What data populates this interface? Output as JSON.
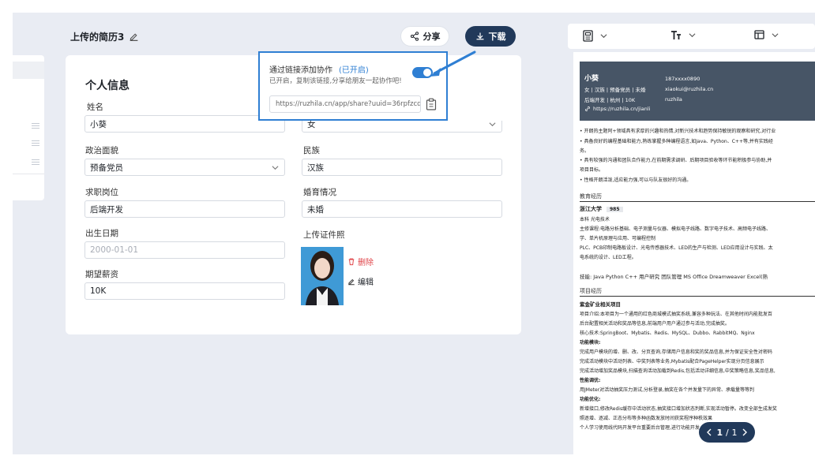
{
  "header": {
    "doc_title": "上传的简历3",
    "share_label": "分享",
    "download_label": "下载"
  },
  "form": {
    "section_title": "个人信息",
    "fields": {
      "name": {
        "label": "姓名",
        "value": "小葵"
      },
      "gender": {
        "label": "",
        "value": "女"
      },
      "political": {
        "label": "政治面貌",
        "value": "预备党员"
      },
      "ethnicity": {
        "label": "民族",
        "value": "汉族"
      },
      "job": {
        "label": "求职岗位",
        "value": "后端开发"
      },
      "marital": {
        "label": "婚育情况",
        "value": "未婚"
      },
      "birth": {
        "label": "出生日期",
        "placeholder": "2000-01-01"
      },
      "salary": {
        "label": "期望薪资",
        "value": "10K"
      },
      "photo": {
        "label": "上传证件照"
      }
    },
    "photo_actions": {
      "delete": "删除",
      "edit": "编辑"
    }
  },
  "share_popover": {
    "title": "通过链接添加协作",
    "status": "(已开启)",
    "description": "已开启，复制该链接,分享给朋友一起协作吧!",
    "link": "https://ruzhila.cn/app/share?uuid=36rpfzcd...",
    "toggle_on": true
  },
  "resume_preview": {
    "name": "小葵",
    "meta_line1": "女 | 汉族 | 预备党员 | 未婚",
    "meta_line2": "后端开发 | 杭州 | 10K",
    "phone": "187xxxx0890",
    "email": "xiaokui@ruzhila.cn",
    "wechat": "ruzhila",
    "website": "https://ruzhila.cn/jianli",
    "summary": [
      "• 开朗热主题阿+领域具有求厚的兴趣和热情,对新兴技术和趋势保持敏锐的观察和研究,对行业",
      "• 具备良好的编程基础和能力,熟练掌握多种编程语言,如Java、Python、C++等,并有实践经",
      "  务。",
      "• 具有较强的沟通和团队合作能力,在前期需求调研、后期项目验收等环节能积极参与协助,并",
      "  项目目标。",
      "• 性格开朗活泼,适应能力强,可以与队友很好的沟通。"
    ],
    "edu_title": "教育经历",
    "school": "浙江大学",
    "school_badge": "985",
    "edu_lines": [
      "本科   光电技术",
      "主修课程:电路分析基础、电子测量与仪器、模拟电子线路、数字电子技术、高频电子线路、",
      "学、单片机原理与应用、可编程控制",
      "PLC、PCB印制电路板设计、光电传感器技术、LED的生产与检测、LED应用设计与实践、太",
      "电系统的设计、LED工程。"
    ],
    "skills": "技能:  Java   Python   C++   用户研究   团队管理   MS Office   Dreamweaver   Excel(熟",
    "proj_title": "项目经历",
    "proj_name": "紫金矿业相关项目",
    "proj_lines": [
      "项目介绍:本项目为一个通用的红色商城模式抽奖系统,兼容多种玩法、在其他时间内能批发百",
      "后台配置相关活动和奖品等信息,前端用户用户通过参与活动,完成抽奖。",
      "核心技术:SpringBoot、Mybatis、Redis、MySQL、Dubbo、RabbitMQ、Nginx",
      "功能模块:",
      "完成用户模块的增、删、改、分页查询,存储用户信息和奖的奖品信息,并为保证安全性对密码",
      "完成活动模块中活动列表、中奖列表等业务,Mybatis配合PageHelper实现分页信息展示",
      "完成活动增加奖品模块,扫描查询活动加载到Redis,包括活动详细信息,中奖策略信息,奖品信息,",
      "性能调优:",
      "用JMeter对活动抽奖压力测试,分析登录,抽奖在各个并发量下的异常、承载量等等判",
      "功能优化:",
      "新增接口,修改Redis缓存中活动状态,抽奖接口增加状态判断,实现活动暂停。改变全部生成发奖",
      "照逐增、逐减、正态分布等多种函数发放时间获奖程序种秩效果",
      "个人学习使用线代码开发平台重要后台管理,进行功能开发"
    ]
  },
  "pager": {
    "current": "1",
    "sep": "/",
    "total": "1"
  }
}
